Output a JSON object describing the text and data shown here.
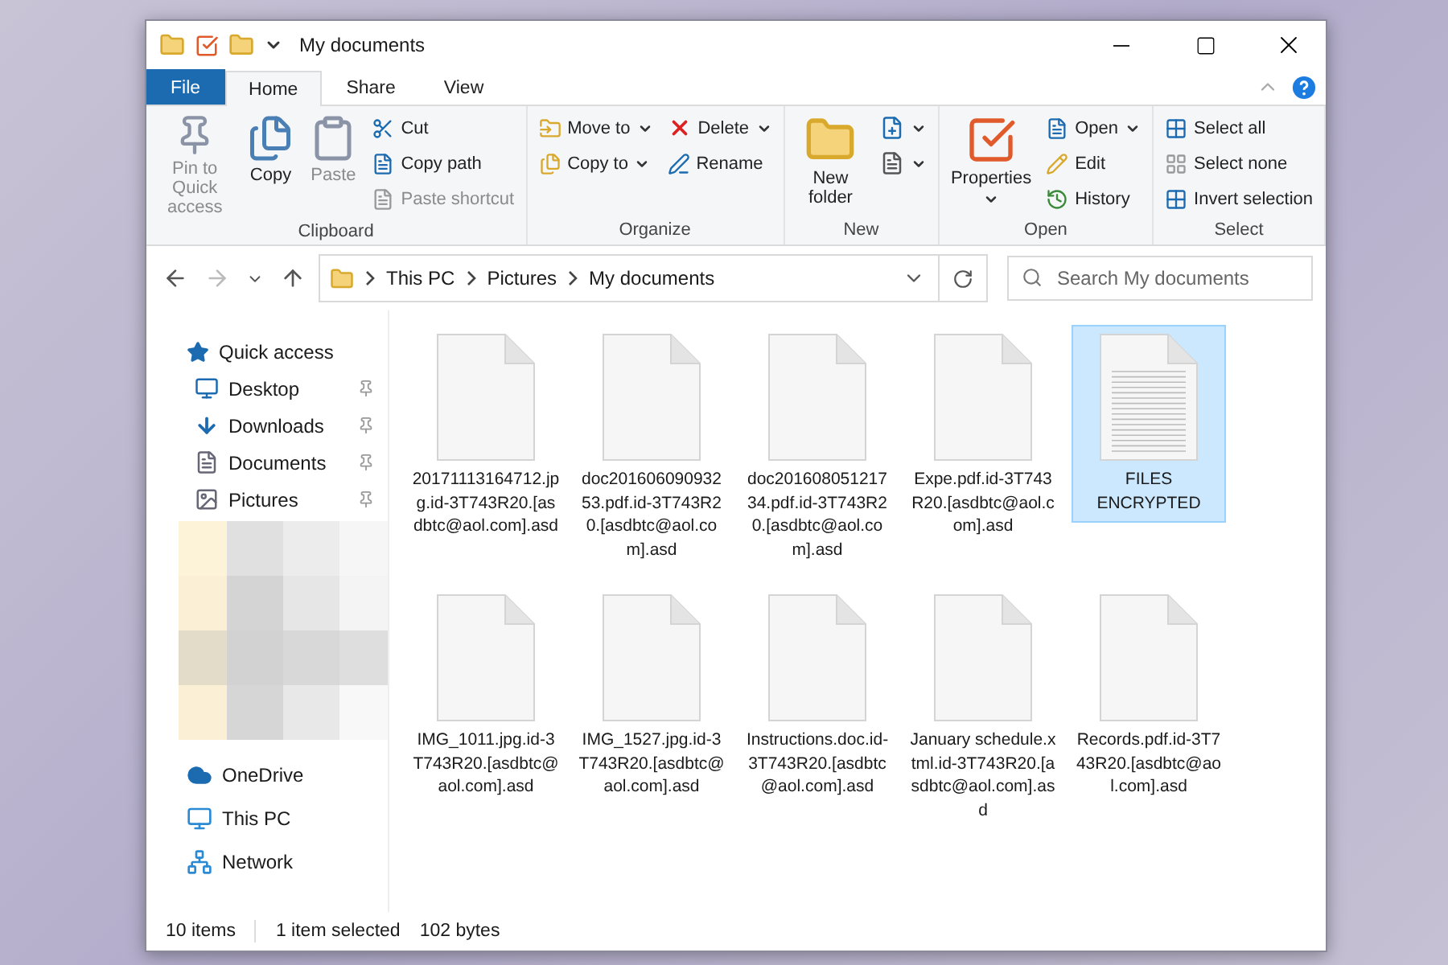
{
  "window": {
    "title": "My documents"
  },
  "ribbon": {
    "tabs": [
      {
        "label": "File",
        "kind": "file",
        "selected": false
      },
      {
        "label": "Home",
        "kind": "tab",
        "selected": true
      },
      {
        "label": "Share",
        "kind": "tab",
        "selected": false
      },
      {
        "label": "View",
        "kind": "tab",
        "selected": false
      }
    ],
    "groups": [
      {
        "name": "Clipboard",
        "columns": [
          [
            {
              "label": "Pin to Quick access",
              "kind": "large",
              "disabled": true
            }
          ],
          [
            {
              "label": "Copy",
              "kind": "large",
              "disabled": false
            }
          ],
          [
            {
              "label": "Paste",
              "kind": "large",
              "disabled": true
            }
          ],
          [
            {
              "label": "Cut",
              "kind": "small",
              "disabled": false
            },
            {
              "label": "Copy path",
              "kind": "small",
              "disabled": false
            },
            {
              "label": "Paste shortcut",
              "kind": "small",
              "disabled": true
            }
          ]
        ]
      },
      {
        "name": "Organize",
        "columns": [
          [
            {
              "label": "Move to",
              "kind": "small",
              "disabled": false,
              "menu": true
            },
            {
              "label": "Copy to",
              "kind": "small",
              "disabled": false,
              "menu": true
            }
          ],
          [
            {
              "label": "Delete",
              "kind": "small",
              "disabled": false,
              "menu": true
            },
            {
              "label": "Rename",
              "kind": "small",
              "disabled": false
            }
          ]
        ]
      },
      {
        "name": "New",
        "columns": [
          [
            {
              "label": "New folder",
              "kind": "large",
              "disabled": false
            }
          ],
          [
            {
              "kind": "icon",
              "disabled": false,
              "menu": true
            },
            {
              "kind": "icon",
              "disabled": false,
              "menu": true
            }
          ]
        ]
      },
      {
        "name": "Open",
        "columns": [
          [
            {
              "label": "Properties",
              "kind": "large",
              "disabled": false,
              "menu": true
            }
          ],
          [
            {
              "label": "Open",
              "kind": "small",
              "disabled": false,
              "menu": true
            },
            {
              "label": "Edit",
              "kind": "small",
              "disabled": false
            },
            {
              "label": "History",
              "kind": "small",
              "disabled": false
            }
          ]
        ]
      },
      {
        "name": "Select",
        "columns": [
          [
            {
              "label": "Select all",
              "kind": "small",
              "disabled": false
            },
            {
              "label": "Select none",
              "kind": "small",
              "disabled": false
            },
            {
              "label": "Invert selection",
              "kind": "small",
              "disabled": false
            }
          ]
        ]
      }
    ]
  },
  "address_bar": {
    "path": [
      "This PC",
      "Pictures",
      "My documents"
    ],
    "search": {
      "placeholder": "Search My documents"
    }
  },
  "sidebar": {
    "items": [
      {
        "label": "Quick access",
        "kind": "header",
        "pinned": false
      },
      {
        "label": "Desktop",
        "kind": "item",
        "pinned": true
      },
      {
        "label": "Downloads",
        "kind": "item",
        "pinned": true
      },
      {
        "label": "Documents",
        "kind": "item",
        "pinned": true
      },
      {
        "label": "Pictures",
        "kind": "item",
        "pinned": true
      },
      {
        "kind": "blurred"
      },
      {
        "label": "OneDrive",
        "kind": "header",
        "pinned": false
      },
      {
        "label": "This PC",
        "kind": "header",
        "pinned": false
      },
      {
        "label": "Network",
        "kind": "header",
        "pinned": false
      }
    ]
  },
  "files": [
    {
      "name": "20171113164712.jpg.id-3T743R20.[asdbtc@aol.com].asd",
      "kind": "blank",
      "selected": false
    },
    {
      "name": "doc20160609093253.pdf.id-3T743R20.[asdbtc@aol.com].asd",
      "kind": "blank",
      "selected": false
    },
    {
      "name": "doc20160805121734.pdf.id-3T743R20.[asdbtc@aol.com].asd",
      "kind": "blank",
      "selected": false
    },
    {
      "name": "Expe.pdf.id-3T743R20.[asdbtc@aol.com].asd",
      "kind": "blank",
      "selected": false
    },
    {
      "name": "FILES ENCRYPTED",
      "kind": "text",
      "selected": true
    },
    {
      "name": "IMG_1011.jpg.id-3T743R20.[asdbtc@aol.com].asd",
      "kind": "blank",
      "selected": false
    },
    {
      "name": "IMG_1527.jpg.id-3T743R20.[asdbtc@aol.com].asd",
      "kind": "blank",
      "selected": false
    },
    {
      "name": "Instructions.doc.id-3T743R20.[asdbtc@aol.com].asd",
      "kind": "blank",
      "selected": false
    },
    {
      "name": "January schedule.xtml.id-3T743R20.[asdbtc@aol.com].asd",
      "kind": "blank",
      "selected": false
    },
    {
      "name": "Records.pdf.id-3T743R20.[asdbtc@aol.com].asd",
      "kind": "blank",
      "selected": false
    }
  ],
  "status_bar": {
    "count": "10 items",
    "selection": "1 item selected",
    "size": "102 bytes"
  }
}
